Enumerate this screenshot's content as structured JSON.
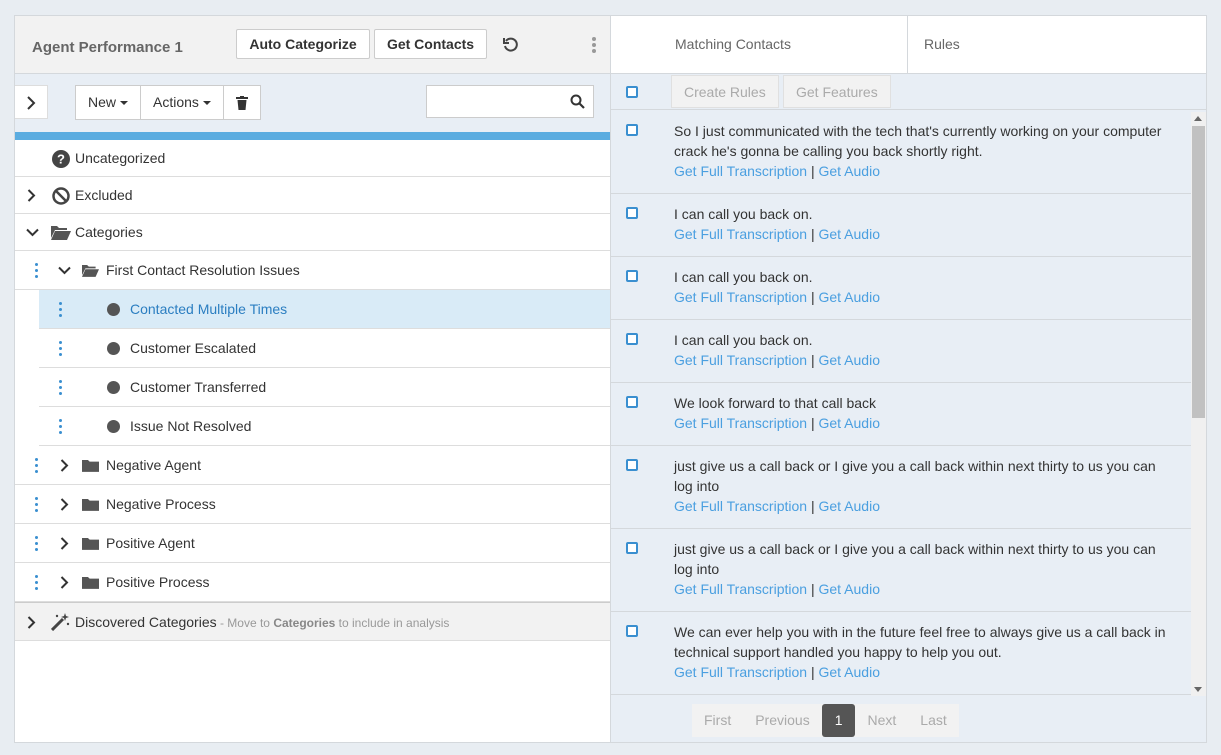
{
  "left": {
    "title": "Agent Performance 1",
    "auto_categorize": "Auto Categorize",
    "get_contacts": "Get Contacts",
    "new_label": "New",
    "actions_label": "Actions",
    "search_placeholder": ""
  },
  "tree": {
    "uncategorized": "Uncategorized",
    "excluded": "Excluded",
    "categories": "Categories",
    "group1": "First Contact Resolution Issues",
    "sub1": "Contacted Multiple Times",
    "sub2": "Customer Escalated",
    "sub3": "Customer Transferred",
    "sub4": "Issue Not Resolved",
    "group2": "Negative Agent",
    "group3": "Negative Process",
    "group4": "Positive Agent",
    "group5": "Positive Process",
    "discovered": "Discovered Categories",
    "discovered_hint_pre": " - Move to ",
    "discovered_hint_bold": "Categories",
    "discovered_hint_post": " to include in analysis"
  },
  "right": {
    "tab_matching": "Matching Contacts",
    "tab_rules": "Rules",
    "create_rules": "Create Rules",
    "get_features": "Get Features",
    "link_transcription": "Get Full Transcription",
    "link_sep": "|",
    "link_audio": "Get Audio",
    "items": [
      "So I just communicated with the tech that's currently working on your computer crack he's gonna be calling you back shortly right.",
      "I can call you back on.",
      "I can call you back on.",
      "I can call you back on.",
      "We look forward to that call back",
      "just give us a call back or I give you a call back within next thirty to us you can log into",
      "just give us a call back or I give you a call back within next thirty to us you can log into",
      "We can ever help you with in the future feel free to always give us a call back in technical support handled you happy to help you out.",
      "We can ever help you with in the future feel free to always give us a call back in"
    ]
  },
  "pager": {
    "first": "First",
    "previous": "Previous",
    "current": "1",
    "next": "Next",
    "last": "Last"
  }
}
